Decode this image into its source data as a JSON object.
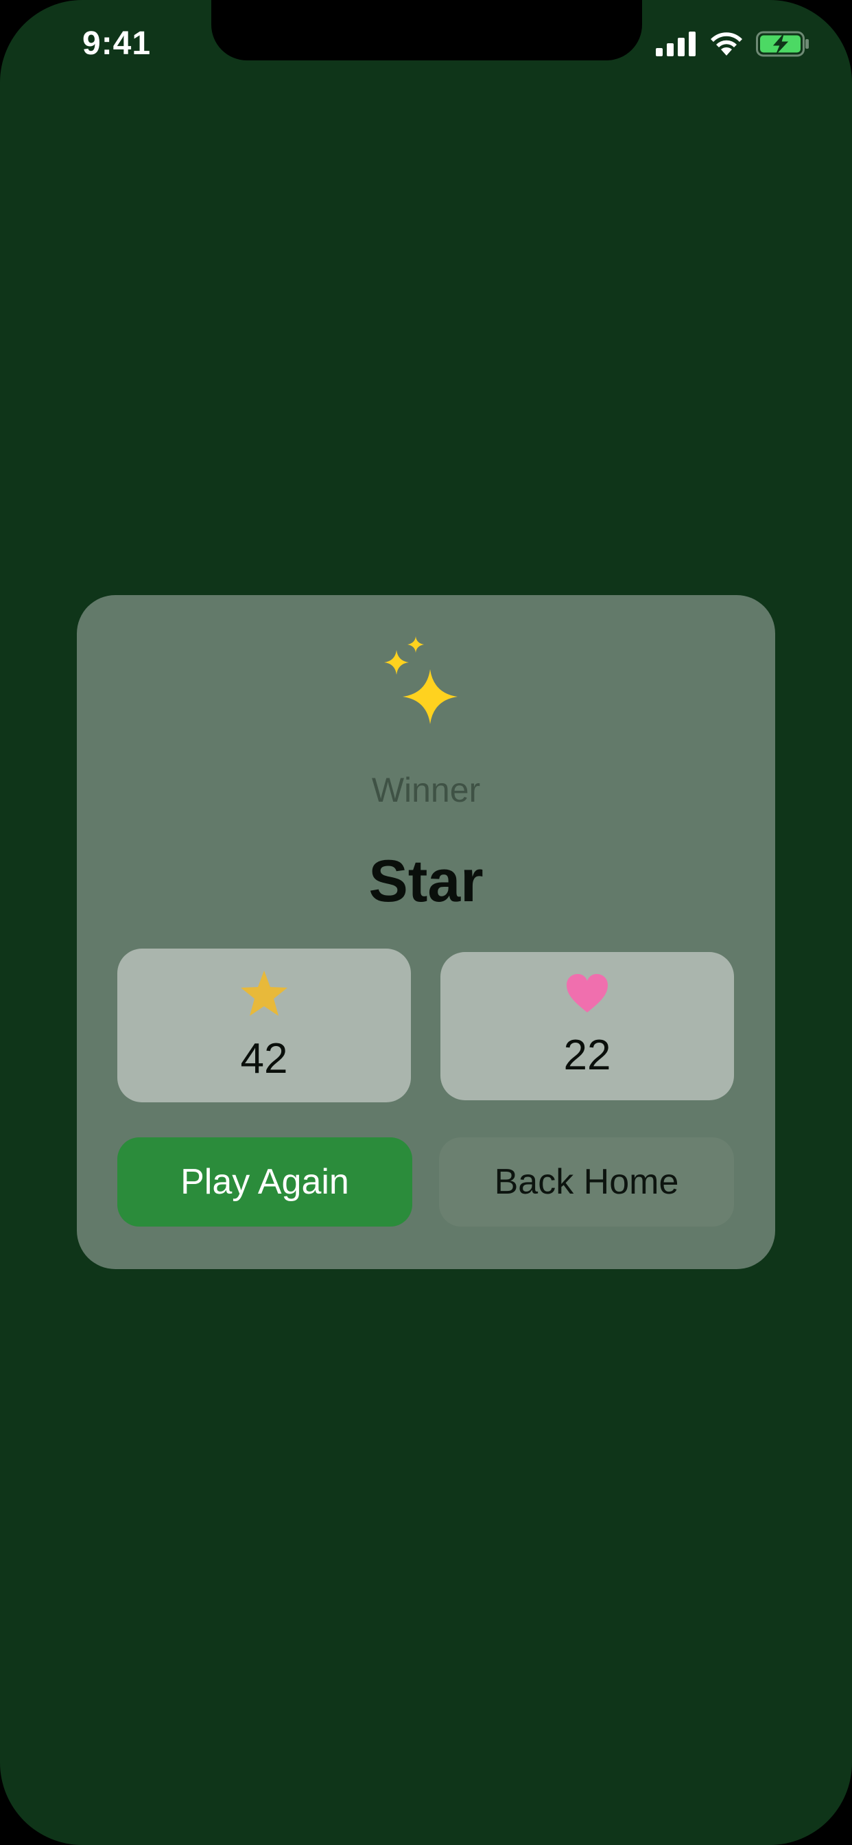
{
  "status_bar": {
    "time": "9:41",
    "icons": [
      "cellular-signal-icon",
      "wifi-icon",
      "battery-charging-icon"
    ],
    "battery_color": "#4cd964"
  },
  "result_card": {
    "icon": "sparkles-icon",
    "label": "Winner",
    "winner_name": "Star",
    "stats": [
      {
        "icon": "star-icon",
        "color": "#e8b93a",
        "value": "42"
      },
      {
        "icon": "heart-icon",
        "color": "#f06fae",
        "value": "22"
      }
    ],
    "buttons": {
      "play_again": "Play Again",
      "back_home": "Back Home"
    }
  },
  "colors": {
    "background": "#0f3519",
    "card": "#637a6a",
    "stat_box": "#aab5ad",
    "primary_button": "#2b8c3b",
    "secondary_button": "#6b8070",
    "sparkle": "#ffd21f"
  }
}
